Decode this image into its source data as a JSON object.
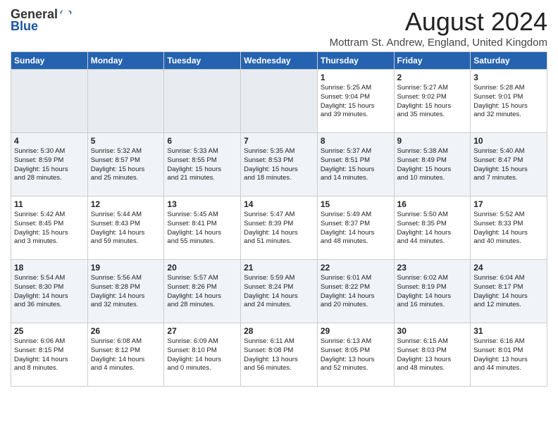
{
  "header": {
    "logo_general": "General",
    "logo_blue": "Blue",
    "title": "August 2024",
    "location": "Mottram St. Andrew, England, United Kingdom"
  },
  "days_of_week": [
    "Sunday",
    "Monday",
    "Tuesday",
    "Wednesday",
    "Thursday",
    "Friday",
    "Saturday"
  ],
  "weeks": [
    [
      {
        "day": "",
        "content": ""
      },
      {
        "day": "",
        "content": ""
      },
      {
        "day": "",
        "content": ""
      },
      {
        "day": "",
        "content": ""
      },
      {
        "day": "1",
        "content": "Sunrise: 5:25 AM\nSunset: 9:04 PM\nDaylight: 15 hours\nand 39 minutes."
      },
      {
        "day": "2",
        "content": "Sunrise: 5:27 AM\nSunset: 9:02 PM\nDaylight: 15 hours\nand 35 minutes."
      },
      {
        "day": "3",
        "content": "Sunrise: 5:28 AM\nSunset: 9:01 PM\nDaylight: 15 hours\nand 32 minutes."
      }
    ],
    [
      {
        "day": "4",
        "content": "Sunrise: 5:30 AM\nSunset: 8:59 PM\nDaylight: 15 hours\nand 28 minutes."
      },
      {
        "day": "5",
        "content": "Sunrise: 5:32 AM\nSunset: 8:57 PM\nDaylight: 15 hours\nand 25 minutes."
      },
      {
        "day": "6",
        "content": "Sunrise: 5:33 AM\nSunset: 8:55 PM\nDaylight: 15 hours\nand 21 minutes."
      },
      {
        "day": "7",
        "content": "Sunrise: 5:35 AM\nSunset: 8:53 PM\nDaylight: 15 hours\nand 18 minutes."
      },
      {
        "day": "8",
        "content": "Sunrise: 5:37 AM\nSunset: 8:51 PM\nDaylight: 15 hours\nand 14 minutes."
      },
      {
        "day": "9",
        "content": "Sunrise: 5:38 AM\nSunset: 8:49 PM\nDaylight: 15 hours\nand 10 minutes."
      },
      {
        "day": "10",
        "content": "Sunrise: 5:40 AM\nSunset: 8:47 PM\nDaylight: 15 hours\nand 7 minutes."
      }
    ],
    [
      {
        "day": "11",
        "content": "Sunrise: 5:42 AM\nSunset: 8:45 PM\nDaylight: 15 hours\nand 3 minutes."
      },
      {
        "day": "12",
        "content": "Sunrise: 5:44 AM\nSunset: 8:43 PM\nDaylight: 14 hours\nand 59 minutes."
      },
      {
        "day": "13",
        "content": "Sunrise: 5:45 AM\nSunset: 8:41 PM\nDaylight: 14 hours\nand 55 minutes."
      },
      {
        "day": "14",
        "content": "Sunrise: 5:47 AM\nSunset: 8:39 PM\nDaylight: 14 hours\nand 51 minutes."
      },
      {
        "day": "15",
        "content": "Sunrise: 5:49 AM\nSunset: 8:37 PM\nDaylight: 14 hours\nand 48 minutes."
      },
      {
        "day": "16",
        "content": "Sunrise: 5:50 AM\nSunset: 8:35 PM\nDaylight: 14 hours\nand 44 minutes."
      },
      {
        "day": "17",
        "content": "Sunrise: 5:52 AM\nSunset: 8:33 PM\nDaylight: 14 hours\nand 40 minutes."
      }
    ],
    [
      {
        "day": "18",
        "content": "Sunrise: 5:54 AM\nSunset: 8:30 PM\nDaylight: 14 hours\nand 36 minutes."
      },
      {
        "day": "19",
        "content": "Sunrise: 5:56 AM\nSunset: 8:28 PM\nDaylight: 14 hours\nand 32 minutes."
      },
      {
        "day": "20",
        "content": "Sunrise: 5:57 AM\nSunset: 8:26 PM\nDaylight: 14 hours\nand 28 minutes."
      },
      {
        "day": "21",
        "content": "Sunrise: 5:59 AM\nSunset: 8:24 PM\nDaylight: 14 hours\nand 24 minutes."
      },
      {
        "day": "22",
        "content": "Sunrise: 6:01 AM\nSunset: 8:22 PM\nDaylight: 14 hours\nand 20 minutes."
      },
      {
        "day": "23",
        "content": "Sunrise: 6:02 AM\nSunset: 8:19 PM\nDaylight: 14 hours\nand 16 minutes."
      },
      {
        "day": "24",
        "content": "Sunrise: 6:04 AM\nSunset: 8:17 PM\nDaylight: 14 hours\nand 12 minutes."
      }
    ],
    [
      {
        "day": "25",
        "content": "Sunrise: 6:06 AM\nSunset: 8:15 PM\nDaylight: 14 hours\nand 8 minutes."
      },
      {
        "day": "26",
        "content": "Sunrise: 6:08 AM\nSunset: 8:12 PM\nDaylight: 14 hours\nand 4 minutes."
      },
      {
        "day": "27",
        "content": "Sunrise: 6:09 AM\nSunset: 8:10 PM\nDaylight: 14 hours\nand 0 minutes."
      },
      {
        "day": "28",
        "content": "Sunrise: 6:11 AM\nSunset: 8:08 PM\nDaylight: 13 hours\nand 56 minutes."
      },
      {
        "day": "29",
        "content": "Sunrise: 6:13 AM\nSunset: 8:05 PM\nDaylight: 13 hours\nand 52 minutes."
      },
      {
        "day": "30",
        "content": "Sunrise: 6:15 AM\nSunset: 8:03 PM\nDaylight: 13 hours\nand 48 minutes."
      },
      {
        "day": "31",
        "content": "Sunrise: 6:16 AM\nSunset: 8:01 PM\nDaylight: 13 hours\nand 44 minutes."
      }
    ]
  ]
}
